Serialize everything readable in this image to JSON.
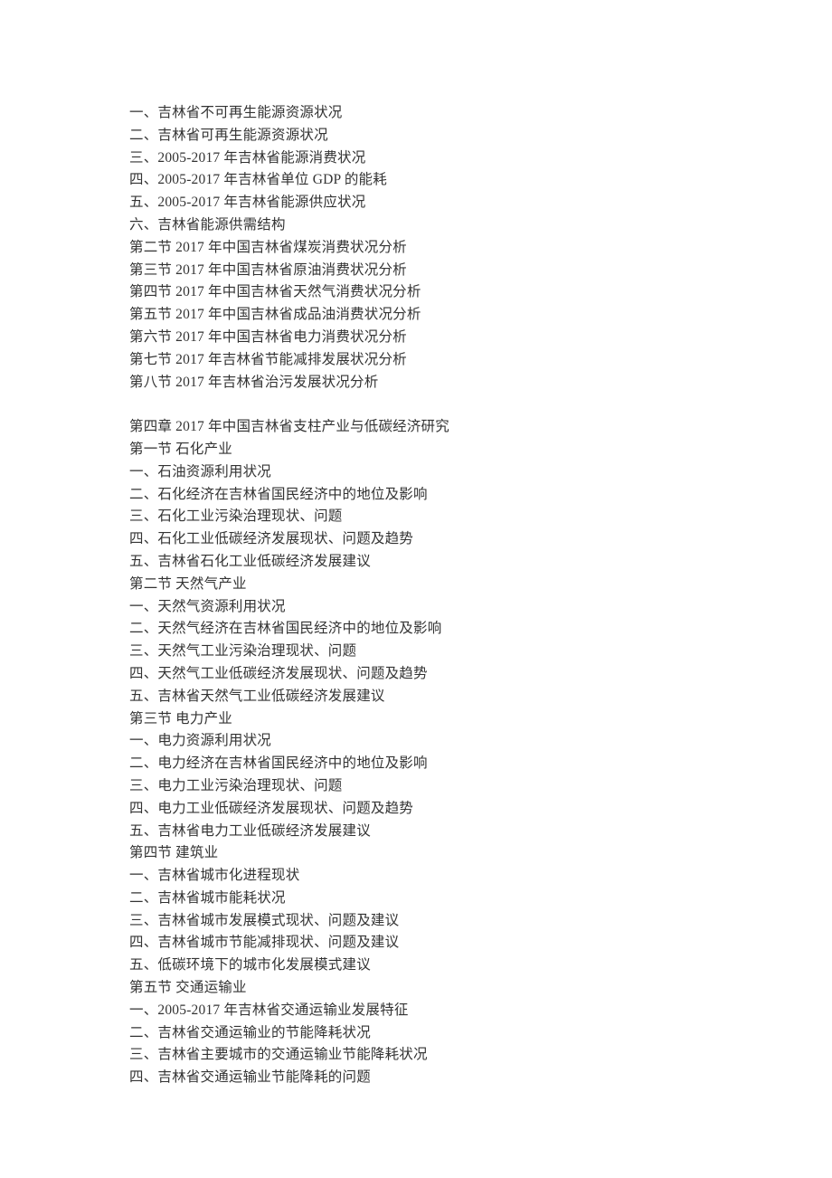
{
  "lines": [
    "一、吉林省不可再生能源资源状况",
    "二、吉林省可再生能源资源状况",
    "三、2005-2017 年吉林省能源消费状况",
    "四、2005-2017 年吉林省单位 GDP 的能耗",
    "五、2005-2017 年吉林省能源供应状况",
    "六、吉林省能源供需结构",
    "第二节 2017 年中国吉林省煤炭消费状况分析",
    "第三节 2017 年中国吉林省原油消费状况分析",
    "第四节 2017 年中国吉林省天然气消费状况分析",
    "第五节 2017 年中国吉林省成品油消费状况分析",
    "第六节 2017 年中国吉林省电力消费状况分析",
    "第七节 2017 年吉林省节能减排发展状况分析",
    "第八节 2017 年吉林省治污发展状况分析",
    "",
    "第四章 2017 年中国吉林省支柱产业与低碳经济研究",
    "第一节 石化产业",
    "一、石油资源利用状况",
    "二、石化经济在吉林省国民经济中的地位及影响",
    "三、石化工业污染治理现状、问题",
    "四、石化工业低碳经济发展现状、问题及趋势",
    "五、吉林省石化工业低碳经济发展建议",
    "第二节 天然气产业",
    "一、天然气资源利用状况",
    "二、天然气经济在吉林省国民经济中的地位及影响",
    "三、天然气工业污染治理现状、问题",
    "四、天然气工业低碳经济发展现状、问题及趋势",
    "五、吉林省天然气工业低碳经济发展建议",
    "第三节 电力产业",
    "一、电力资源利用状况",
    "二、电力经济在吉林省国民经济中的地位及影响",
    "三、电力工业污染治理现状、问题",
    "四、电力工业低碳经济发展现状、问题及趋势",
    "五、吉林省电力工业低碳经济发展建议",
    "第四节 建筑业",
    "一、吉林省城市化进程现状",
    "二、吉林省城市能耗状况",
    "三、吉林省城市发展模式现状、问题及建议",
    "四、吉林省城市节能减排现状、问题及建议",
    "五、低碳环境下的城市化发展模式建议",
    "第五节 交通运输业",
    "一、2005-2017 年吉林省交通运输业发展特征",
    "二、吉林省交通运输业的节能降耗状况",
    "三、吉林省主要城市的交通运输业节能降耗状况",
    "四、吉林省交通运输业节能降耗的问题"
  ]
}
